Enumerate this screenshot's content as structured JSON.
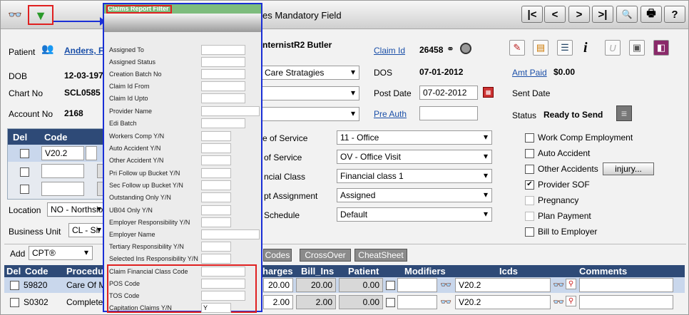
{
  "toolbar": {
    "title_partial": "es Mandatory Field",
    "nav_first": "|<",
    "nav_prev": "<",
    "nav_next": ">",
    "nav_last": ">|",
    "search_glyph": "🔍",
    "print_glyph": "🖶",
    "help": "?"
  },
  "patient": {
    "patient_label": "Patient",
    "patient_name": "Anders, F",
    "dob_label": "DOB",
    "dob_value": "12-03-197",
    "chart_label": "Chart No",
    "chart_value": "SCL0585",
    "account_label": "Account No",
    "account_value": "2168"
  },
  "claim": {
    "provider_partial": "nternistR2 Butler",
    "facility_partial": "Care Stratagies",
    "claim_id_label": "Claim Id",
    "claim_id_value": "26458",
    "dos_label": "DOS",
    "dos_value": "07-01-2012",
    "post_date_label": "Post Date",
    "post_date_value": "07-02-2012",
    "pre_auth_label": "Pre Auth",
    "pre_auth_value": "",
    "amt_paid_label": "Amt Paid",
    "amt_paid_value": "$0.00",
    "sent_date_label": "Sent Date",
    "status_label": "Status",
    "status_value": "Ready to Send"
  },
  "dx_grid": {
    "col_del": "Del",
    "col_code": "Code",
    "rows": [
      {
        "code": "V20.2"
      },
      {
        "code": ""
      },
      {
        "code": ""
      }
    ]
  },
  "location": {
    "location_label": "Location",
    "location_value": "NO - Northsio",
    "business_unit_label": "Business Unit",
    "business_unit_value": "CL - Sir"
  },
  "service": {
    "pos_label_partial": "e of Service",
    "pos_value": "11 - Office",
    "tos_label_partial": "of Service",
    "tos_value": "OV - Office Visit",
    "fin_label_partial": "ncial Class",
    "fin_value": "Financial class 1",
    "assign_label_partial": "pt Assignment",
    "assign_value": "Assigned",
    "fee_label_partial": "Schedule",
    "fee_value": "Default"
  },
  "checks": [
    {
      "label": "Work Comp Employment",
      "checked": false
    },
    {
      "label": "Auto Accident",
      "checked": false
    },
    {
      "label": "Other Accidents",
      "checked": false
    },
    {
      "label": "Provider SOF",
      "checked": true
    },
    {
      "label": "Pregnancy",
      "checked": false
    },
    {
      "label": "Plan Payment",
      "checked": false
    },
    {
      "label": "Bill to Employer",
      "checked": false
    }
  ],
  "injury_button": "injury...",
  "add_row": {
    "add_label": "Add",
    "add_value": "CPT®",
    "codes_btn": "Codes",
    "crossover_btn": "CrossOver",
    "cheatsheet_btn": "CheatSheet"
  },
  "proc_grid": {
    "col_del": "Del",
    "col_code": "Code",
    "col_proc": "Procedu",
    "col_charges": "harges",
    "col_bill_ins": "Bill_Ins",
    "col_patient": "Patient",
    "col_modifiers": "Modifiers",
    "col_icds": "Icds",
    "col_comments": "Comments",
    "rows": [
      {
        "code": "59820",
        "proc": "Care Of M",
        "charges": "20.00",
        "bill_ins": "20.00",
        "patient": "0.00",
        "icd": "V20.2"
      },
      {
        "code": "S0302",
        "proc": "Complete",
        "charges": "2.00",
        "bill_ins": "2.00",
        "patient": "0.00",
        "icd": "V20.2"
      }
    ]
  },
  "filter_panel": {
    "title": "Claims Report Filter",
    "fields": [
      {
        "label": "Assigned To",
        "value": ""
      },
      {
        "label": "Assigned Status",
        "value": ""
      },
      {
        "label": "Creation Batch No",
        "value": ""
      },
      {
        "label": "Claim Id From",
        "value": ""
      },
      {
        "label": "Claim Id Upto",
        "value": ""
      },
      {
        "label": "Provider Name",
        "value": ""
      },
      {
        "label": "Edi Batch",
        "value": ""
      },
      {
        "label": "Workers Comp Y/N",
        "value": ""
      },
      {
        "label": "Auto Accident Y/N",
        "value": ""
      },
      {
        "label": "Other Accident Y/N",
        "value": ""
      },
      {
        "label": "Pri Follow up Bucket Y/N",
        "value": ""
      },
      {
        "label": "Sec Follow up Bucket Y/N",
        "value": ""
      },
      {
        "label": "Outstanding Only Y/N",
        "value": ""
      },
      {
        "label": "UB04 Only Y/N",
        "value": ""
      },
      {
        "label": "Employer Responsibility Y/N",
        "value": ""
      },
      {
        "label": "Employer Name",
        "value": ""
      },
      {
        "label": "Tertiary Responsibility Y/N",
        "value": ""
      },
      {
        "label": "Selected Ins Responsibility Y/N",
        "value": ""
      },
      {
        "label": "Claim Financial Class Code",
        "value": ""
      },
      {
        "label": "POS Code",
        "value": ""
      },
      {
        "label": "TOS Code",
        "value": ""
      },
      {
        "label": "Capitation Claims Y/N",
        "value": "Y"
      }
    ]
  },
  "colors": {
    "header_blue": "#2e4a77",
    "highlight_red": "#e02020",
    "panel_border": "#1a2fd6",
    "panel_title_green": "#7dbc7d",
    "link_blue": "#1a4fa8"
  }
}
